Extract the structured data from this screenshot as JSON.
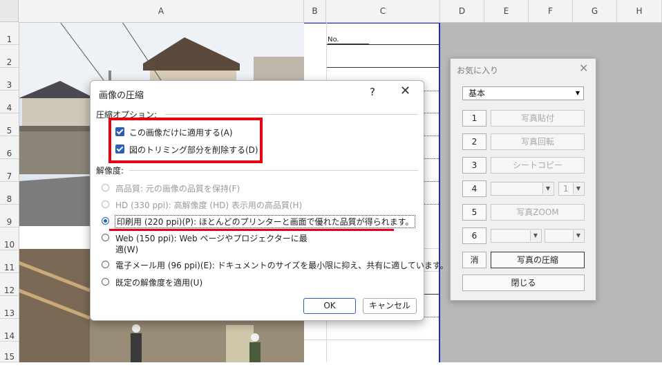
{
  "sheet": {
    "columns": [
      "A",
      "B",
      "C",
      "D",
      "E",
      "F",
      "G",
      "H"
    ],
    "rows": [
      "1",
      "2",
      "3",
      "4",
      "5",
      "6",
      "7",
      "8",
      "9",
      "10",
      "11",
      "12",
      "13",
      "14",
      "15"
    ],
    "cell_c1": "No."
  },
  "dialog": {
    "title": "画像の圧縮",
    "help": "?",
    "close": "✕",
    "section_compress": "圧縮オプション:",
    "opt_apply_only": "この画像だけに適用する(A)",
    "opt_delete_crop": "図のトリミング部分を削除する(D)",
    "section_resolution": "解像度:",
    "res_high": "高品質: 元の画像の品質を保持(F)",
    "res_hd": "HD (330 ppi): 高解像度 (HD) 表示用の高品質(H)",
    "res_print": "印刷用 (220 ppi)(P): ほとんどのプリンターと画面で優れた品質が得られます。",
    "res_web_line1": "Web (150 ppi): Web ページやプロジェクターに最",
    "res_web_line2": "適(W)",
    "res_email": "電子メール用 (96 ppi)(E): ドキュメントのサイズを最小限に抑え、共有に適しています。",
    "res_default": "既定の解像度を適用(U)",
    "ok": "OK",
    "cancel": "キャンセル"
  },
  "favorites": {
    "title": "お気に入り",
    "close": "✕",
    "preset": "基本",
    "btn1": "1",
    "btn2": "2",
    "btn3": "3",
    "btn4": "4",
    "btn5": "5",
    "btn6": "6",
    "erase": "消",
    "photo_paste": "写真貼付",
    "photo_rotate": "写真回転",
    "sheet_copy": "シートコピー",
    "spin_value": "1",
    "photo_zoom": "写真ZOOM",
    "photo_compress": "写真の圧縮",
    "close_btn": "閉じる"
  }
}
